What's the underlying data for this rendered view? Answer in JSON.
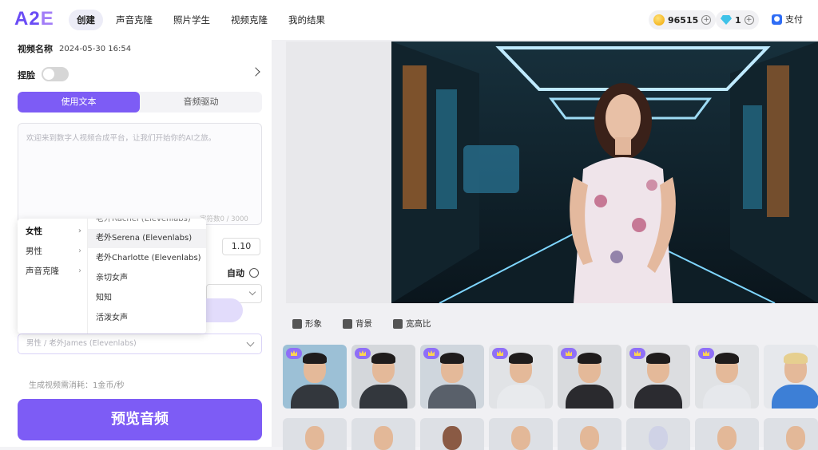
{
  "header": {
    "logo_a": "A2",
    "logo_e": "E",
    "nav": [
      "创建",
      "声音克隆",
      "照片学生",
      "视频克隆",
      "我的结果"
    ],
    "coins": "96515",
    "gems": "1",
    "pay": "支付"
  },
  "form": {
    "video_name_label": "视频名称",
    "video_name_value": "2024-05-30 16:54",
    "face_label": "捏脸",
    "tab_text": "使用文本",
    "tab_audio": "音频驱动",
    "textarea_placeholder": "欢迎来到数字人视频合成平台，让我们开始你的AI之旅。",
    "counter": "字符数0 / 3000",
    "speed": "1.10",
    "auto": "自动",
    "voice_select": "男性 / 老外James (Elevenlabs)",
    "cost": "生成视频需消耗：1金币/秒",
    "preview": "预览音频"
  },
  "voice_menu": {
    "categories": [
      "女性",
      "男性",
      "声音克隆"
    ],
    "voices": [
      "老外Rachel (Elevenlabs)",
      "老外Serena (Elevenlabs)",
      "老外Charlotte (Elevenlabs)",
      "亲切女声",
      "知知",
      "活泼女声"
    ]
  },
  "media_tabs": [
    "形象",
    "背景",
    "宽高比"
  ],
  "colors": {
    "accent": "#7d5cf5",
    "accent_light": "#e2dcfb"
  }
}
